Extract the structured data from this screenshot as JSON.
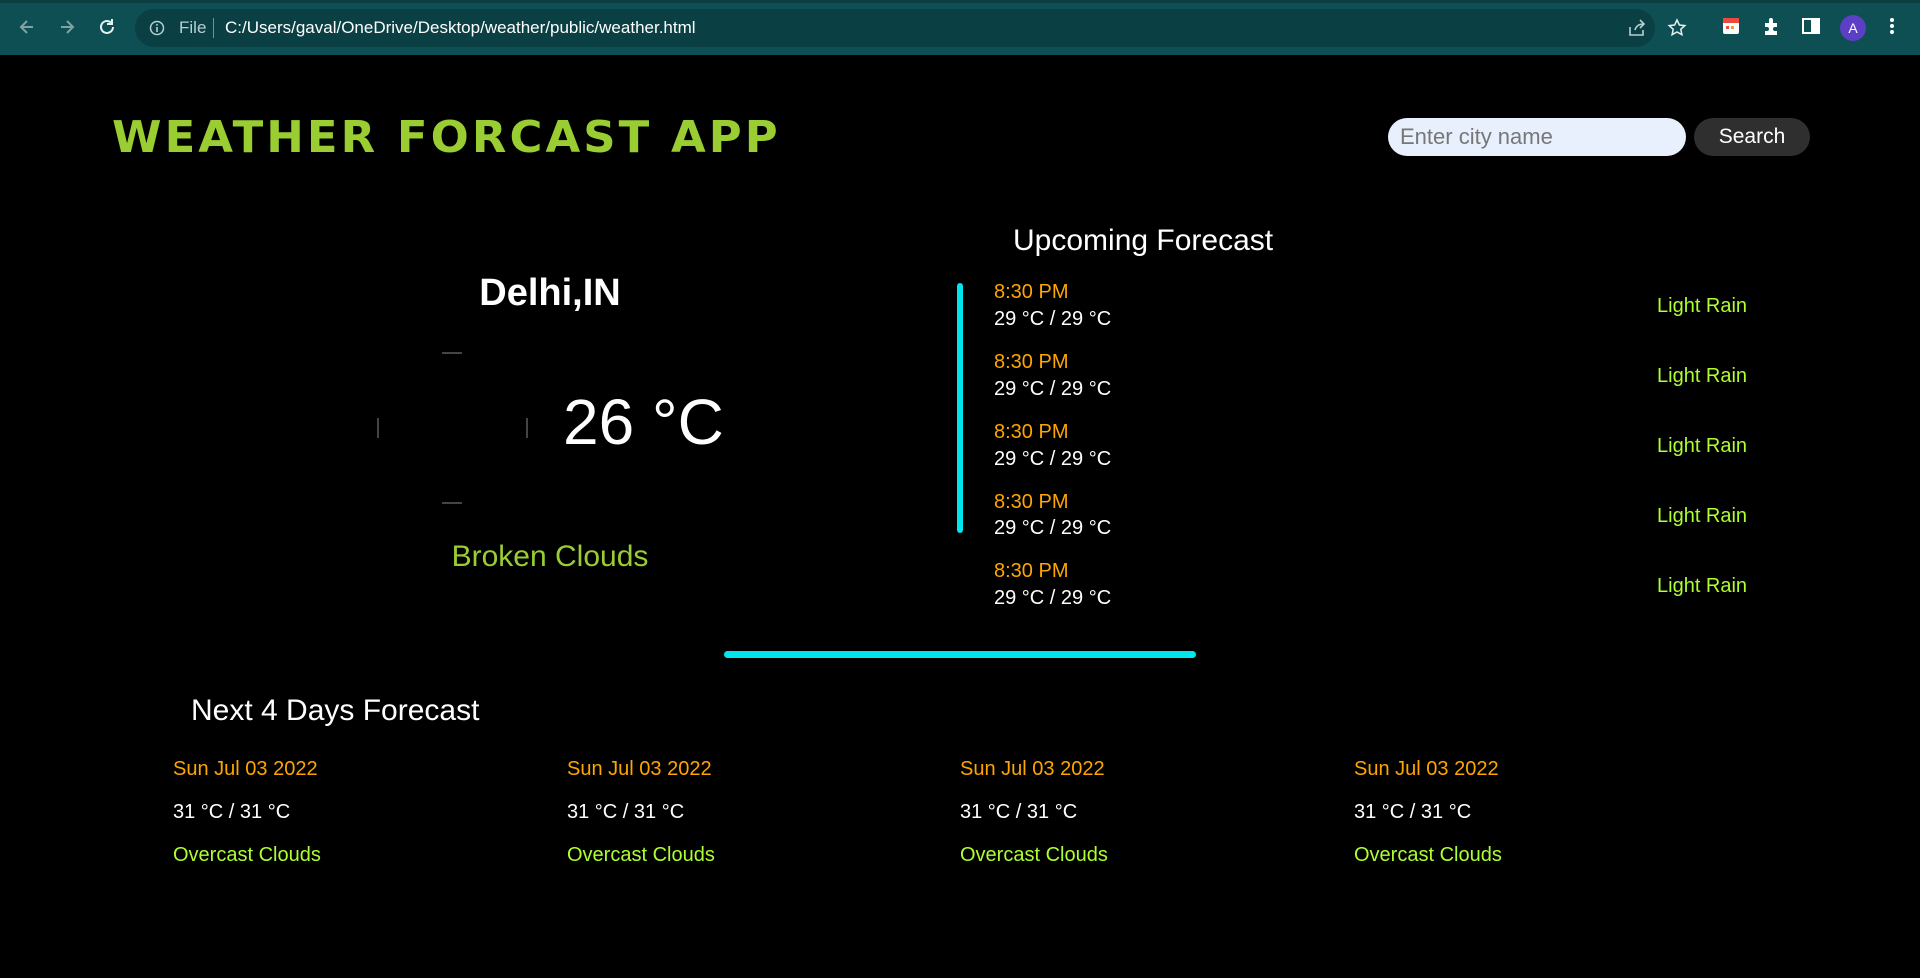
{
  "browser": {
    "file_label": "File",
    "url": "C:/Users/gaval/OneDrive/Desktop/weather/public/weather.html",
    "avatar_letter": "A",
    "icons": [
      "back-arrow-icon",
      "forward-arrow-icon",
      "reload-icon",
      "info-icon",
      "share-icon",
      "star-icon",
      "extension-icon",
      "puzzle-icon",
      "side-panel-icon",
      "kebab-menu-icon"
    ]
  },
  "header": {
    "title": "WEATHER FORCAST APP",
    "search_placeholder": "Enter city name",
    "search_label": "Search"
  },
  "current": {
    "city": "Delhi,IN",
    "temperature": "26 °C",
    "condition": "Broken Clouds"
  },
  "upcoming": {
    "title": "Upcoming Forecast",
    "items": [
      {
        "time": "8:30 PM",
        "temp": "29 °C / 29 °C",
        "desc": "Light Rain"
      },
      {
        "time": "8:30 PM",
        "temp": "29 °C / 29 °C",
        "desc": "Light Rain"
      },
      {
        "time": "8:30 PM",
        "temp": "29 °C / 29 °C",
        "desc": "Light Rain"
      },
      {
        "time": "8:30 PM",
        "temp": "29 °C / 29 °C",
        "desc": "Light Rain"
      },
      {
        "time": "8:30 PM",
        "temp": "29 °C / 29 °C",
        "desc": "Light Rain"
      }
    ]
  },
  "days": {
    "title": "Next 4 Days Forecast",
    "items": [
      {
        "date": "Sun Jul 03 2022",
        "temp": "31 °C / 31 °C",
        "desc": "Overcast Clouds"
      },
      {
        "date": "Sun Jul 03 2022",
        "temp": "31 °C / 31 °C",
        "desc": "Overcast Clouds"
      },
      {
        "date": "Sun Jul 03 2022",
        "temp": "31 °C / 31 °C",
        "desc": "Overcast Clouds"
      },
      {
        "date": "Sun Jul 03 2022",
        "temp": "31 °C / 31 °C",
        "desc": "Overcast Clouds"
      }
    ]
  },
  "colors": {
    "title": "#9acd32",
    "accent_bar": "#00e5ee",
    "time": "#ffa500",
    "description": "#adff2f"
  }
}
